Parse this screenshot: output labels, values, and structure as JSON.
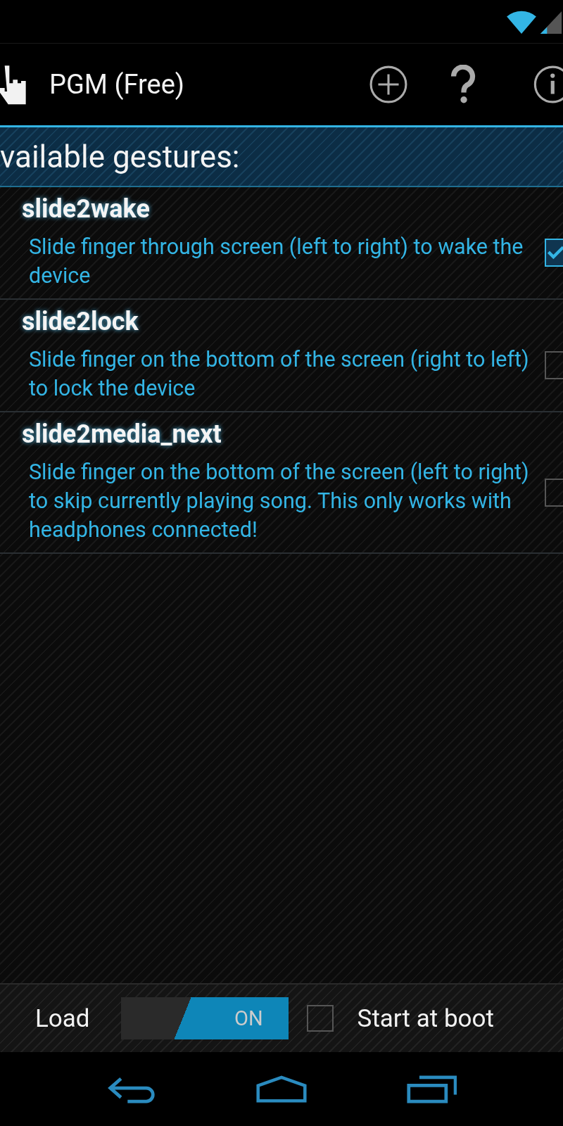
{
  "action_bar": {
    "title": "PGM (Free)"
  },
  "header": {
    "title": "vailable gestures:"
  },
  "gestures": [
    {
      "name": "slide2wake",
      "description": "Slide finger through screen (left to right) to wake the device",
      "checked": true
    },
    {
      "name": "slide2lock",
      "description": "Slide finger on the bottom of the screen (right to left) to lock the device",
      "checked": false
    },
    {
      "name": "slide2media_next",
      "description": "Slide finger on the bottom of the screen (left to right) to skip currently playing song. This only works with headphones connected!",
      "checked": false
    }
  ],
  "bottom_bar": {
    "load_label": "Load",
    "toggle": {
      "label": "ON",
      "on": true
    },
    "start_at_boot": {
      "label": "Start at boot",
      "checked": false
    }
  }
}
